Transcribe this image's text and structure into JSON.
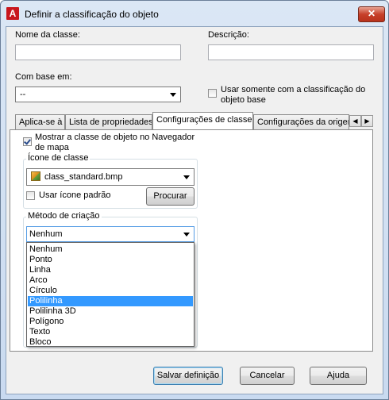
{
  "window": {
    "title": "Definir a classificação do objeto",
    "close_label": "✕"
  },
  "labels": {
    "class_name": "Nome da classe:",
    "description": "Descrição:",
    "based_on": "Com base em:",
    "use_only": "Usar somente com a classificação do objeto base"
  },
  "fields": {
    "class_name_value": "",
    "description_value": "",
    "based_on_value": "--"
  },
  "tabs": [
    {
      "label": "Aplica-se à"
    },
    {
      "label": "Lista de propriedades"
    },
    {
      "label": "Configurações de classe"
    },
    {
      "label": "Configurações da origem"
    }
  ],
  "tab_scroll": {
    "left": "◀",
    "right": "▶"
  },
  "class_settings": {
    "show_in_navigator": "Mostrar a classe de objeto no Navegador de mapa",
    "icon_group_title": "Ícone de classe",
    "icon_value": "class_standard.bmp",
    "use_default_icon": "Usar ícone padrão",
    "browse_button": "Procurar",
    "creation_group_title": "Método de criação",
    "creation_value": "Nenhum",
    "creation_options": [
      "Nenhum",
      "Ponto",
      "Linha",
      "Arco",
      "Círculo",
      "Polilinha",
      "Polilinha 3D",
      "Polígono",
      "Texto",
      "Bloco"
    ],
    "highlighted_option": "Polilinha"
  },
  "buttons": {
    "save": "Salvar definição",
    "cancel": "Cancelar",
    "help": "Ajuda"
  }
}
